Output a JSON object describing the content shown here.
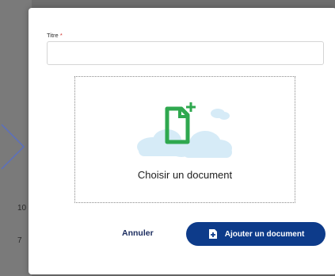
{
  "background": {
    "row_numbers": [
      "10",
      "7"
    ]
  },
  "modal": {
    "title_field": {
      "label": "Titre",
      "required_mark": "*",
      "value": "",
      "placeholder": ""
    },
    "dropzone": {
      "label": "Choisir un document",
      "icons": [
        "file-add-icon",
        "cloud-icon"
      ]
    },
    "actions": {
      "cancel_label": "Annuler",
      "submit_label": "Ajouter un document",
      "submit_icon": "file-plus-icon"
    }
  },
  "colors": {
    "primary": "#0d3b8a",
    "link": "#1a2b5e",
    "required": "#d0312d",
    "icon_green": "#2fa84f",
    "cloud": "#d6ebf7"
  }
}
